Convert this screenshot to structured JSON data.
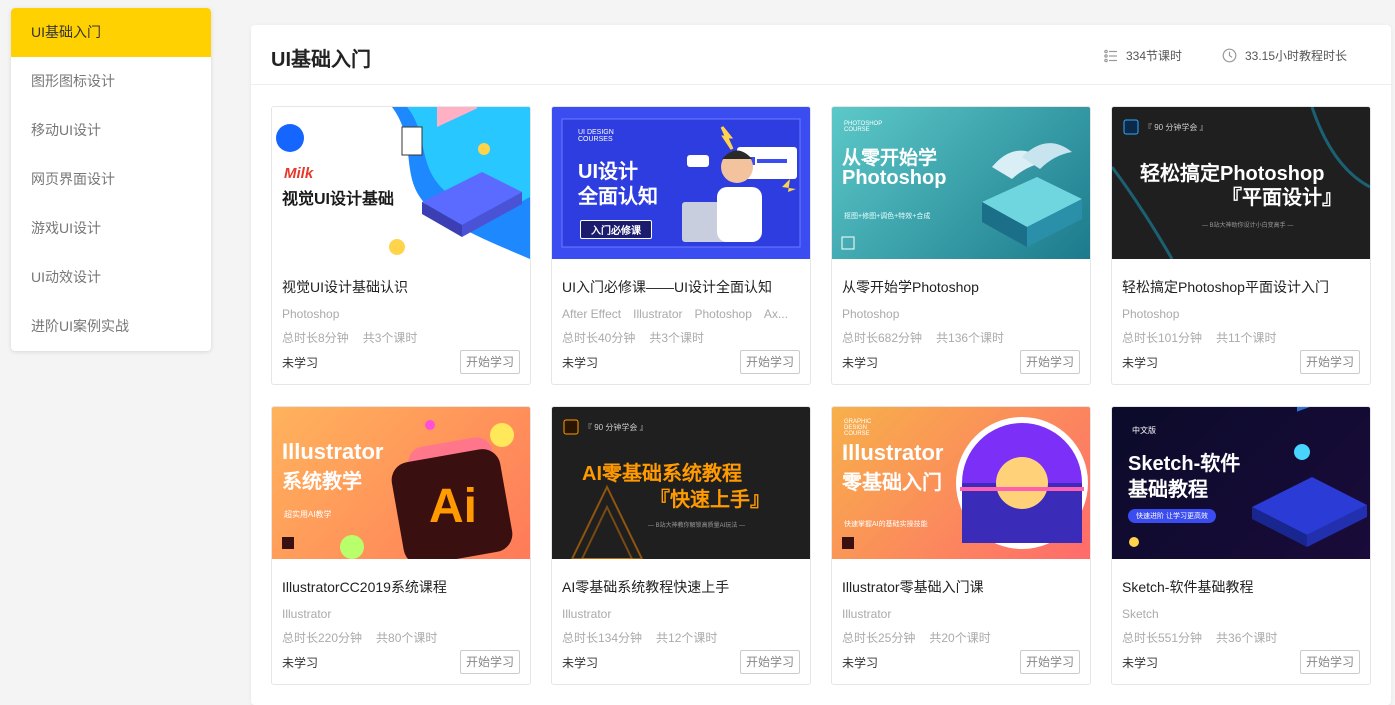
{
  "sidebar": {
    "items": [
      {
        "label": "UI基础入门"
      },
      {
        "label": "图形图标设计"
      },
      {
        "label": "移动UI设计"
      },
      {
        "label": "网页界面设计"
      },
      {
        "label": "游戏UI设计"
      },
      {
        "label": "UI动效设计"
      },
      {
        "label": "进阶UI案例实战"
      }
    ]
  },
  "header": {
    "title": "UI基础入门",
    "lessons": "334节课时",
    "hours": "33.15小时教程时长"
  },
  "courses": [
    {
      "title": "视觉UI设计基础认识",
      "tags": [
        "Photoshop"
      ],
      "duration": "总时长8分钟",
      "lessons": "共3个课时",
      "status": "未学习",
      "button": "开始学习",
      "thumb": {
        "line1": "Milk",
        "line2": "视觉UI设计基础"
      }
    },
    {
      "title": "UI入门必修课——UI设计全面认知",
      "tags": [
        "After Effect",
        "Illustrator",
        "Photoshop",
        "Ax..."
      ],
      "duration": "总时长40分钟",
      "lessons": "共3个课时",
      "status": "未学习",
      "button": "开始学习",
      "thumb": {
        "small": "UI DESIGN COURSES",
        "line1": "UI设计",
        "line2": "全面认知",
        "badge": "入门必修课"
      }
    },
    {
      "title": "从零开始学Photoshop",
      "tags": [
        "Photoshop"
      ],
      "duration": "总时长682分钟",
      "lessons": "共136个课时",
      "status": "未学习",
      "button": "开始学习",
      "thumb": {
        "small": "PHOTOSHOP COURSE",
        "line1": "从零开始学",
        "line2": "Photoshop",
        "sub": "抠图+修图+调色+特效+合成"
      }
    },
    {
      "title": "轻松搞定Photoshop平面设计入门",
      "tags": [
        "Photoshop"
      ],
      "duration": "总时长101分钟",
      "lessons": "共11个课时",
      "status": "未学习",
      "button": "开始学习",
      "thumb": {
        "top": "『 90 分钟学会 』",
        "line1": "轻松搞定Photoshop",
        "line2": "『平面设计』",
        "sub": "— B站大神助你设计小白变高手 —"
      }
    },
    {
      "title": "IllustratorCC2019系统课程",
      "tags": [
        "Illustrator"
      ],
      "duration": "总时长220分钟",
      "lessons": "共80个课时",
      "status": "未学习",
      "button": "开始学习",
      "thumb": {
        "line1": "Illustrator",
        "line2": "系统教学",
        "logo": "Ai",
        "sub": "超实用AI教学"
      }
    },
    {
      "title": "AI零基础系统教程快速上手",
      "tags": [
        "Illustrator"
      ],
      "duration": "总时长134分钟",
      "lessons": "共12个课时",
      "status": "未学习",
      "button": "开始学习",
      "thumb": {
        "top": "『 90 分钟学会 』",
        "line1": "AI零基础系统教程",
        "line2": "『快速上手』",
        "sub": "— B站大神教你解锁高质量AI玩法 —"
      }
    },
    {
      "title": "Illustrator零基础入门课",
      "tags": [
        "Illustrator"
      ],
      "duration": "总时长25分钟",
      "lessons": "共20个课时",
      "status": "未学习",
      "button": "开始学习",
      "thumb": {
        "small": "GRAPHIC DESIGN COURSE",
        "line1": "Illustrator",
        "line2": "零基础入门",
        "sub": "快速掌握AI的基础实操技能"
      }
    },
    {
      "title": "Sketch-软件基础教程",
      "tags": [
        "Sketch"
      ],
      "duration": "总时长551分钟",
      "lessons": "共36个课时",
      "status": "未学习",
      "button": "开始学习",
      "thumb": {
        "top": "中文版",
        "line1": "Sketch-软件",
        "line2": "基础教程",
        "badge": "快速进阶 让学习更高效"
      }
    }
  ],
  "colors": {
    "accent": "#ffd100"
  }
}
